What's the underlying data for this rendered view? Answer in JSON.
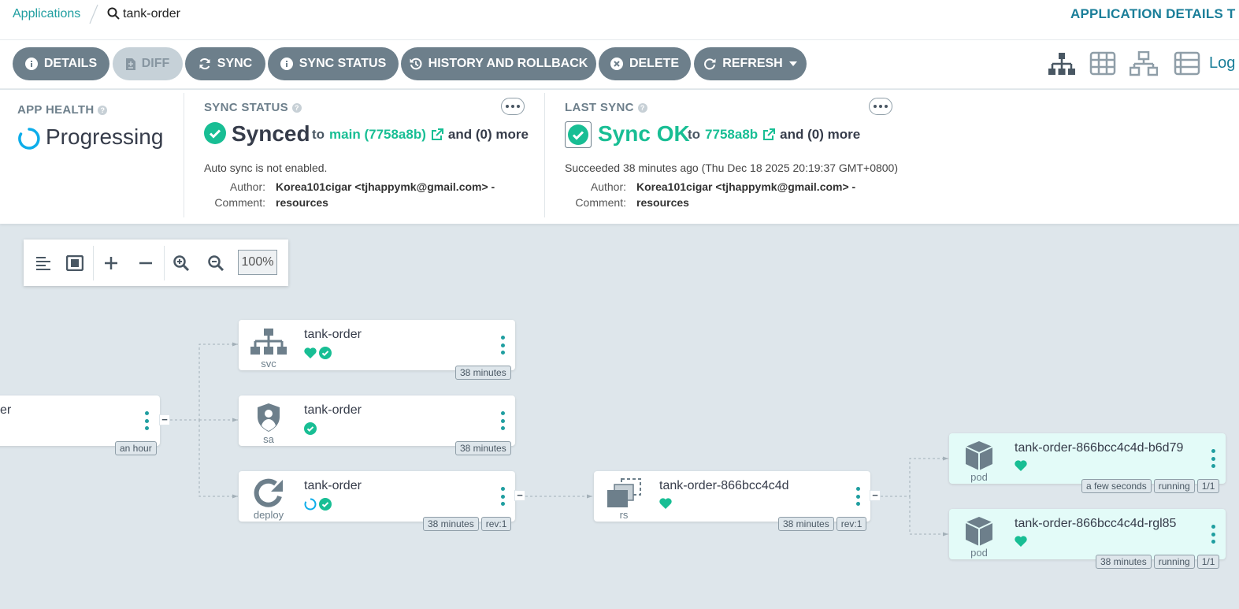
{
  "breadcrumb": {
    "root": "Applications",
    "current": "tank-order"
  },
  "page_title": "APPLICATION DETAILS T",
  "toolbar": {
    "details": "DETAILS",
    "diff": "DIFF",
    "sync": "SYNC",
    "sync_status": "SYNC STATUS",
    "history": "HISTORY AND ROLLBACK",
    "delete": "DELETE",
    "refresh": "REFRESH",
    "logs": "Log"
  },
  "app_health": {
    "label": "APP HEALTH",
    "status": "Progressing"
  },
  "sync_status": {
    "label": "SYNC STATUS",
    "status": "Synced",
    "to": "to",
    "revision": "main (7758a8b)",
    "and_more": "and (0) more",
    "auto_sync": "Auto sync is not enabled.",
    "author_key": "Author:",
    "author": "Korea101cigar <tjhappymk@gmail.com> -",
    "comment_key": "Comment:",
    "comment": "resources"
  },
  "last_sync": {
    "label": "LAST SYNC",
    "status": "Sync OK",
    "to": "to",
    "revision": "7758a8b",
    "and_more": "and (0) more",
    "succeeded": "Succeeded 38 minutes ago (Thu Dec 18 2025 20:19:37 GMT+0800)",
    "author_key": "Author:",
    "author": "Korea101cigar <tjhappymk@gmail.com> -",
    "comment_key": "Comment:",
    "comment": "resources"
  },
  "zoom": {
    "level": "100%"
  },
  "nodes": {
    "app": {
      "name": "er",
      "tags": [
        "an hour"
      ]
    },
    "svc": {
      "name": "tank-order",
      "kind": "svc",
      "tags": [
        "38 minutes"
      ]
    },
    "sa": {
      "name": "tank-order",
      "kind": "sa",
      "tags": [
        "38 minutes"
      ]
    },
    "deploy": {
      "name": "tank-order",
      "kind": "deploy",
      "tags": [
        "38 minutes",
        "rev:1"
      ]
    },
    "rs": {
      "name": "tank-order-866bcc4c4d",
      "kind": "rs",
      "tags": [
        "38 minutes",
        "rev:1"
      ]
    },
    "pod1": {
      "name": "tank-order-866bcc4c4d-b6d79",
      "kind": "pod",
      "tags": [
        "a few seconds",
        "running",
        "1/1"
      ]
    },
    "pod2": {
      "name": "tank-order-866bcc4c4d-rgl85",
      "kind": "pod",
      "tags": [
        "38 minutes",
        "running",
        "1/1"
      ]
    }
  },
  "colors": {
    "accent": "#1f9ea0",
    "healthy": "#18be94",
    "progressing": "#0dadea",
    "button": "#6d7f8b"
  }
}
